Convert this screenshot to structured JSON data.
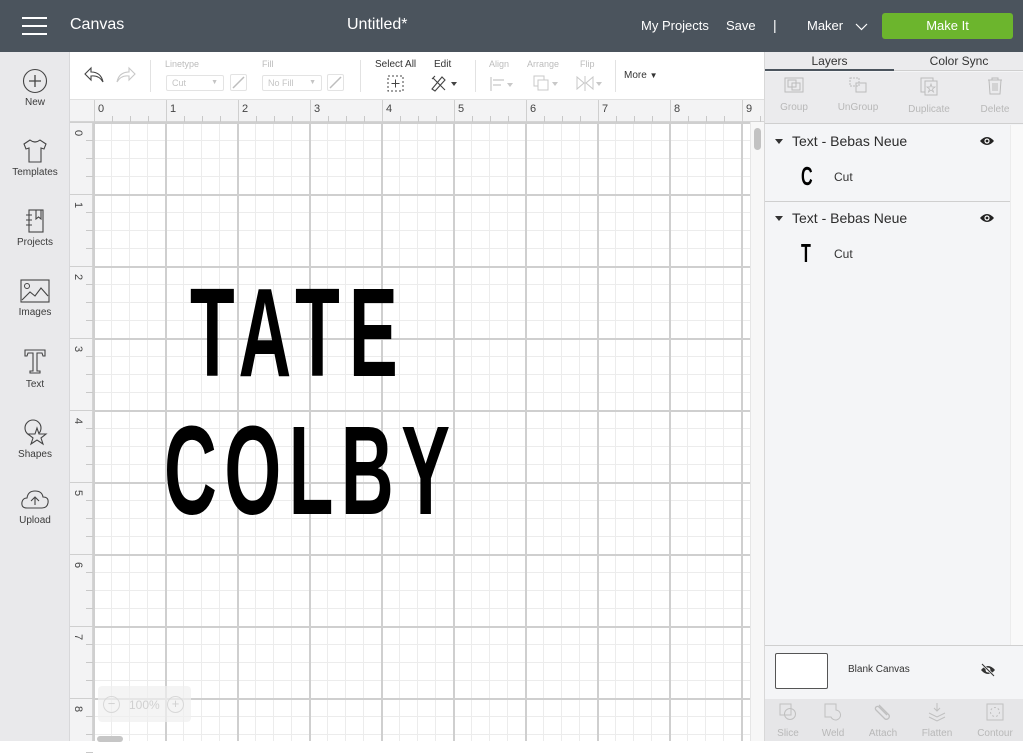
{
  "topbar": {
    "app_title": "Canvas",
    "document_title": "Untitled*",
    "my_projects": "My Projects",
    "save": "Save",
    "separator": "|",
    "machine": "Maker",
    "make_it": "Make It",
    "make_it_color": "#6cb52d",
    "bar_color": "#4b545d"
  },
  "sidebar": {
    "items": [
      {
        "label": "New",
        "icon": "plus-circle-icon"
      },
      {
        "label": "Templates",
        "icon": "tshirt-icon"
      },
      {
        "label": "Projects",
        "icon": "notebook-icon"
      },
      {
        "label": "Images",
        "icon": "image-icon"
      },
      {
        "label": "Text",
        "icon": "text-t-icon"
      },
      {
        "label": "Shapes",
        "icon": "shapes-icon"
      },
      {
        "label": "Upload",
        "icon": "cloud-upload-icon"
      }
    ]
  },
  "toolbar": {
    "undo": "undo-icon",
    "redo": "redo-icon",
    "linetype_label": "Linetype",
    "linetype_value": "Cut",
    "fill_label": "Fill",
    "fill_value": "No Fill",
    "select_all": "Select All",
    "edit": "Edit",
    "align": "Align",
    "arrange": "Arrange",
    "flip": "Flip",
    "more": "More"
  },
  "rulers": {
    "horizontal": [
      "0",
      "1",
      "2",
      "3",
      "4",
      "5",
      "6",
      "7",
      "8",
      "9"
    ],
    "vertical": [
      "0",
      "1",
      "2",
      "3",
      "4",
      "5",
      "6",
      "7",
      "8"
    ]
  },
  "canvas": {
    "texts": [
      {
        "content": "TATE"
      },
      {
        "content": "COLBY"
      }
    ],
    "zoom_level": "100%",
    "zoom_out": "−",
    "zoom_in": "+"
  },
  "right_panel": {
    "tabs": [
      "Layers",
      "Color Sync"
    ],
    "active_tab": "Layers",
    "layer_actions": [
      "Group",
      "UnGroup",
      "Duplicate",
      "Delete"
    ],
    "layers": [
      {
        "name": "Text - Bebas Neue",
        "glyph": "C",
        "operation": "Cut"
      },
      {
        "name": "Text - Bebas Neue",
        "glyph": "T",
        "operation": "Cut"
      }
    ],
    "blank_canvas": "Blank Canvas",
    "bottom_actions": [
      "Slice",
      "Weld",
      "Attach",
      "Flatten",
      "Contour"
    ]
  }
}
